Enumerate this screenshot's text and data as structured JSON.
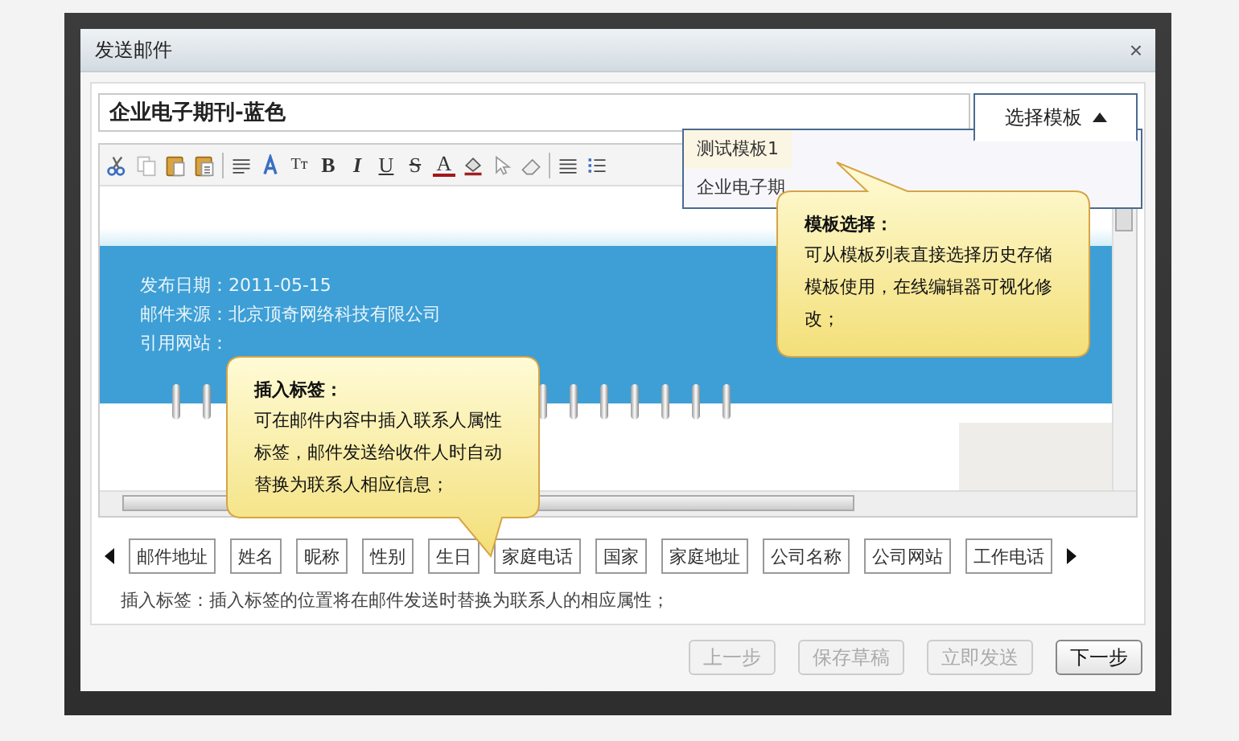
{
  "window": {
    "title": "发送邮件",
    "close": "×"
  },
  "subject": {
    "value": "企业电子期刊-蓝色"
  },
  "template_button": {
    "label": "选择模板",
    "expanded": true
  },
  "template_menu": [
    {
      "label": "测试模板1",
      "selected": true
    },
    {
      "label": "企业电子期",
      "selected": false
    }
  ],
  "toolbar": {
    "glyphs": [
      "Tт",
      "B",
      "I",
      "U",
      "S",
      "A"
    ]
  },
  "editor": {
    "lines": [
      "发布日期：2011-05-15",
      "邮件来源：北京顶奇网络科技有限公司",
      "引用网站："
    ]
  },
  "tags": [
    "邮件地址",
    "姓名",
    "昵称",
    "性别",
    "生日",
    "家庭电话",
    "国家",
    "家庭地址",
    "公司名称",
    "公司网站",
    "工作电话"
  ],
  "hint": "插入标签：插入标签的位置将在邮件发送时替换为联系人的相应属性；",
  "buttons": [
    {
      "label": "上一步",
      "disabled": true
    },
    {
      "label": "保存草稿",
      "disabled": true
    },
    {
      "label": "立即发送",
      "disabled": true
    },
    {
      "label": "下一步",
      "disabled": false
    }
  ],
  "tooltips": [
    {
      "title": "模板选择：",
      "text": "可从模板列表直接选择历史存储模板使用，在线编辑器可视化修改；"
    },
    {
      "title": "插入标签：",
      "text": "可在邮件内容中插入联系人属性标签，邮件发送给收件人时自动替换为联系人相应信息；"
    }
  ]
}
